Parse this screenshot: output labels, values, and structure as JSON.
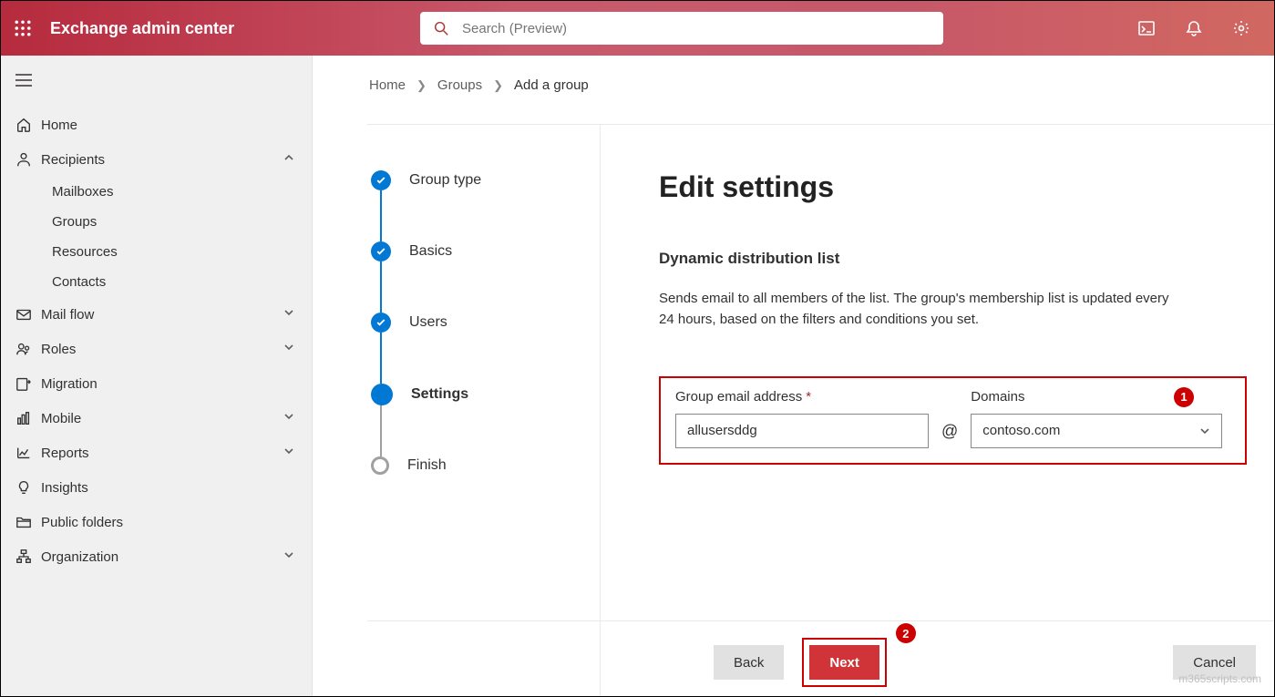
{
  "header": {
    "app_title": "Exchange admin center",
    "search_placeholder": "Search (Preview)"
  },
  "sidebar": {
    "items": [
      {
        "label": "Home",
        "icon": "home",
        "expandable": false
      },
      {
        "label": "Recipients",
        "icon": "person",
        "expandable": true,
        "expanded": true,
        "children": [
          "Mailboxes",
          "Groups",
          "Resources",
          "Contacts"
        ]
      },
      {
        "label": "Mail flow",
        "icon": "mail",
        "expandable": true
      },
      {
        "label": "Roles",
        "icon": "roles",
        "expandable": true
      },
      {
        "label": "Migration",
        "icon": "migration",
        "expandable": false
      },
      {
        "label": "Mobile",
        "icon": "mobile",
        "expandable": true
      },
      {
        "label": "Reports",
        "icon": "reports",
        "expandable": true
      },
      {
        "label": "Insights",
        "icon": "insights",
        "expandable": false
      },
      {
        "label": "Public folders",
        "icon": "folders",
        "expandable": false
      },
      {
        "label": "Organization",
        "icon": "org",
        "expandable": true
      }
    ]
  },
  "breadcrumb": {
    "items": [
      "Home",
      "Groups",
      "Add a group"
    ]
  },
  "wizard": {
    "steps": [
      {
        "label": "Group type",
        "state": "done"
      },
      {
        "label": "Basics",
        "state": "done"
      },
      {
        "label": "Users",
        "state": "done"
      },
      {
        "label": "Settings",
        "state": "current"
      },
      {
        "label": "Finish",
        "state": "pending"
      }
    ]
  },
  "pane": {
    "title": "Edit settings",
    "subtitle": "Dynamic distribution list",
    "description": "Sends email to all members of the list. The group's membership list is updated every 24 hours, based on the filters and conditions you set.",
    "email_label": "Group email address",
    "email_value": "allusersddg",
    "domain_label": "Domains",
    "domain_value": "contoso.com",
    "at": "@"
  },
  "footer": {
    "back": "Back",
    "next": "Next",
    "cancel": "Cancel"
  },
  "annotations": {
    "badge1": "1",
    "badge2": "2"
  },
  "watermark": "m365scripts.com"
}
